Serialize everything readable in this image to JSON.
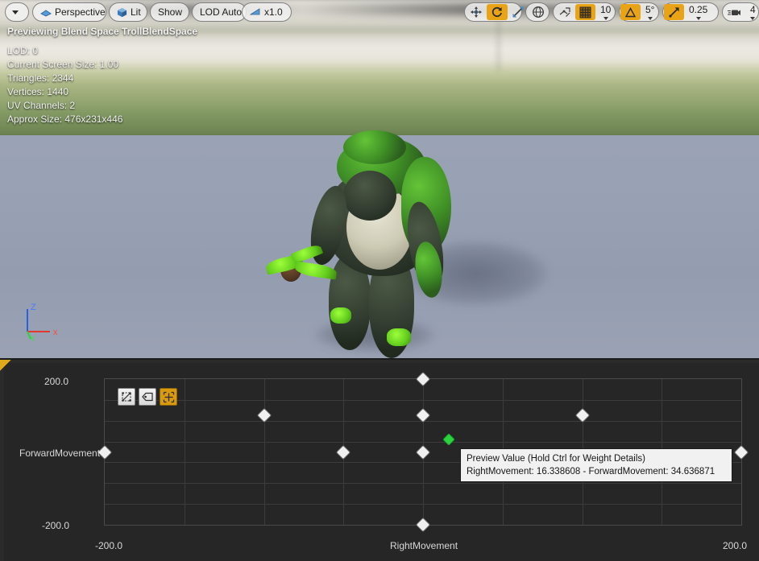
{
  "toolbar": {
    "viewport_menu_icon": "chevron-down-icon",
    "view_mode": "Perspective",
    "view_mode_icon": "perspective-icon",
    "lit_mode": "Lit",
    "lit_mode_icon": "cube-icon",
    "show_menu": "Show",
    "lod_menu": "LOD Auto",
    "playback_speed": "x1.0",
    "playback_icon": "play-speed-icon",
    "translate_icon": "move-gizmo-icon",
    "rotate_icon": "rotate-gizmo-icon",
    "scale_icon": "scale-gizmo-icon",
    "coordinate_icon": "world-globe-icon",
    "surface_snap_icon": "surface-snap-icon",
    "grid_snap_icon": "grid-snap-icon",
    "grid_snap_value": "10",
    "angle_snap_icon": "angle-snap-icon",
    "angle_snap_value": "5°",
    "scale_snap_icon": "scale-snap-icon",
    "scale_snap_value": "0.25",
    "camera_speed_icon": "camera-speed-icon",
    "camera_speed_value": "4"
  },
  "stats": {
    "title": "Previewing Blend Space TrollBlendSpace",
    "lines": [
      "LOD: 0",
      "Current Screen Size: 1.00",
      "Triangles: 2344",
      "Vertices: 1440",
      "UV Channels: 2",
      "Approx Size: 476x231x446"
    ]
  },
  "gizmo": {
    "x_label": "x",
    "y_label": "y",
    "z_label": "Z"
  },
  "plot_tools": [
    {
      "name": "toggle-triangulation-button",
      "icon": "triangulation-icon",
      "active": false
    },
    {
      "name": "toggle-labels-button",
      "icon": "label-tag-icon",
      "active": false
    },
    {
      "name": "toggle-animation-names-button",
      "icon": "fit-grid-icon",
      "active": true
    }
  ],
  "tooltip": {
    "line1": "Preview Value (Hold Ctrl for Weight Details)",
    "line2": "RightMovement: 16.338608 - ForwardMovement: 34.636871"
  },
  "chart_data": {
    "type": "scatter",
    "title": "TrollBlendSpace",
    "xlabel": "RightMovement",
    "ylabel": "ForwardMovement",
    "xlim": [
      -200.0,
      200.0
    ],
    "ylim": [
      -200.0,
      200.0
    ],
    "x_min_label": "-200.0",
    "x_max_label": "200.0",
    "y_min_label": "-200.0",
    "y_max_label": "200.0",
    "grid": true,
    "grid_cols": 8,
    "grid_rows": 7,
    "samples": [
      {
        "x": -200.0,
        "y": 0.0
      },
      {
        "x": 0.0,
        "y": 200.0
      },
      {
        "x": 0.0,
        "y": 100.0
      },
      {
        "x": 0.0,
        "y": 0.0
      },
      {
        "x": 0.0,
        "y": -200.0
      },
      {
        "x": -100.0,
        "y": 100.0
      },
      {
        "x": -50.0,
        "y": 0.0
      },
      {
        "x": 100.0,
        "y": 100.0
      },
      {
        "x": 200.0,
        "y": 0.0
      }
    ],
    "preview_point": {
      "x": 16.338608,
      "y": 34.636871
    }
  }
}
